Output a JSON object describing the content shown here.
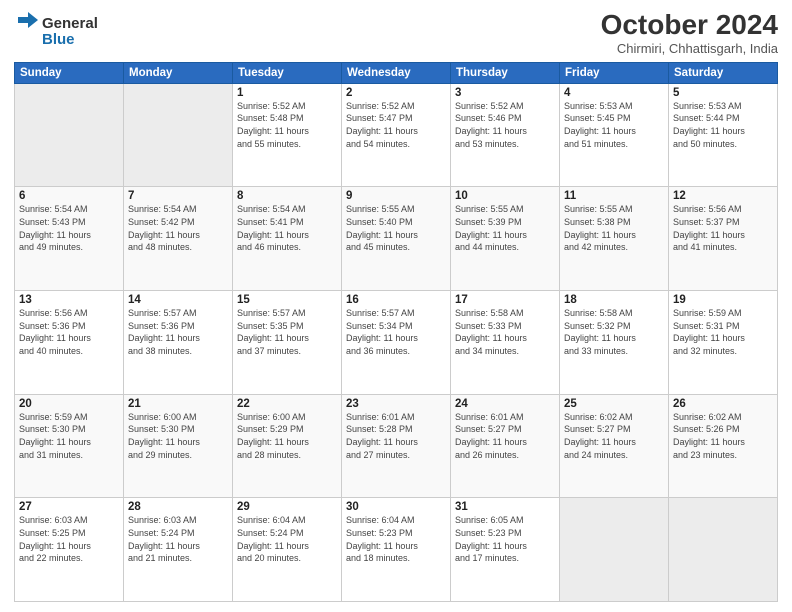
{
  "logo": {
    "line1": "General",
    "line2": "Blue"
  },
  "title": "October 2024",
  "subtitle": "Chirmiri, Chhattisgarh, India",
  "header_days": [
    "Sunday",
    "Monday",
    "Tuesday",
    "Wednesday",
    "Thursday",
    "Friday",
    "Saturday"
  ],
  "weeks": [
    [
      {
        "day": "",
        "info": ""
      },
      {
        "day": "",
        "info": ""
      },
      {
        "day": "1",
        "info": "Sunrise: 5:52 AM\nSunset: 5:48 PM\nDaylight: 11 hours\nand 55 minutes."
      },
      {
        "day": "2",
        "info": "Sunrise: 5:52 AM\nSunset: 5:47 PM\nDaylight: 11 hours\nand 54 minutes."
      },
      {
        "day": "3",
        "info": "Sunrise: 5:52 AM\nSunset: 5:46 PM\nDaylight: 11 hours\nand 53 minutes."
      },
      {
        "day": "4",
        "info": "Sunrise: 5:53 AM\nSunset: 5:45 PM\nDaylight: 11 hours\nand 51 minutes."
      },
      {
        "day": "5",
        "info": "Sunrise: 5:53 AM\nSunset: 5:44 PM\nDaylight: 11 hours\nand 50 minutes."
      }
    ],
    [
      {
        "day": "6",
        "info": "Sunrise: 5:54 AM\nSunset: 5:43 PM\nDaylight: 11 hours\nand 49 minutes."
      },
      {
        "day": "7",
        "info": "Sunrise: 5:54 AM\nSunset: 5:42 PM\nDaylight: 11 hours\nand 48 minutes."
      },
      {
        "day": "8",
        "info": "Sunrise: 5:54 AM\nSunset: 5:41 PM\nDaylight: 11 hours\nand 46 minutes."
      },
      {
        "day": "9",
        "info": "Sunrise: 5:55 AM\nSunset: 5:40 PM\nDaylight: 11 hours\nand 45 minutes."
      },
      {
        "day": "10",
        "info": "Sunrise: 5:55 AM\nSunset: 5:39 PM\nDaylight: 11 hours\nand 44 minutes."
      },
      {
        "day": "11",
        "info": "Sunrise: 5:55 AM\nSunset: 5:38 PM\nDaylight: 11 hours\nand 42 minutes."
      },
      {
        "day": "12",
        "info": "Sunrise: 5:56 AM\nSunset: 5:37 PM\nDaylight: 11 hours\nand 41 minutes."
      }
    ],
    [
      {
        "day": "13",
        "info": "Sunrise: 5:56 AM\nSunset: 5:36 PM\nDaylight: 11 hours\nand 40 minutes."
      },
      {
        "day": "14",
        "info": "Sunrise: 5:57 AM\nSunset: 5:36 PM\nDaylight: 11 hours\nand 38 minutes."
      },
      {
        "day": "15",
        "info": "Sunrise: 5:57 AM\nSunset: 5:35 PM\nDaylight: 11 hours\nand 37 minutes."
      },
      {
        "day": "16",
        "info": "Sunrise: 5:57 AM\nSunset: 5:34 PM\nDaylight: 11 hours\nand 36 minutes."
      },
      {
        "day": "17",
        "info": "Sunrise: 5:58 AM\nSunset: 5:33 PM\nDaylight: 11 hours\nand 34 minutes."
      },
      {
        "day": "18",
        "info": "Sunrise: 5:58 AM\nSunset: 5:32 PM\nDaylight: 11 hours\nand 33 minutes."
      },
      {
        "day": "19",
        "info": "Sunrise: 5:59 AM\nSunset: 5:31 PM\nDaylight: 11 hours\nand 32 minutes."
      }
    ],
    [
      {
        "day": "20",
        "info": "Sunrise: 5:59 AM\nSunset: 5:30 PM\nDaylight: 11 hours\nand 31 minutes."
      },
      {
        "day": "21",
        "info": "Sunrise: 6:00 AM\nSunset: 5:30 PM\nDaylight: 11 hours\nand 29 minutes."
      },
      {
        "day": "22",
        "info": "Sunrise: 6:00 AM\nSunset: 5:29 PM\nDaylight: 11 hours\nand 28 minutes."
      },
      {
        "day": "23",
        "info": "Sunrise: 6:01 AM\nSunset: 5:28 PM\nDaylight: 11 hours\nand 27 minutes."
      },
      {
        "day": "24",
        "info": "Sunrise: 6:01 AM\nSunset: 5:27 PM\nDaylight: 11 hours\nand 26 minutes."
      },
      {
        "day": "25",
        "info": "Sunrise: 6:02 AM\nSunset: 5:27 PM\nDaylight: 11 hours\nand 24 minutes."
      },
      {
        "day": "26",
        "info": "Sunrise: 6:02 AM\nSunset: 5:26 PM\nDaylight: 11 hours\nand 23 minutes."
      }
    ],
    [
      {
        "day": "27",
        "info": "Sunrise: 6:03 AM\nSunset: 5:25 PM\nDaylight: 11 hours\nand 22 minutes."
      },
      {
        "day": "28",
        "info": "Sunrise: 6:03 AM\nSunset: 5:24 PM\nDaylight: 11 hours\nand 21 minutes."
      },
      {
        "day": "29",
        "info": "Sunrise: 6:04 AM\nSunset: 5:24 PM\nDaylight: 11 hours\nand 20 minutes."
      },
      {
        "day": "30",
        "info": "Sunrise: 6:04 AM\nSunset: 5:23 PM\nDaylight: 11 hours\nand 18 minutes."
      },
      {
        "day": "31",
        "info": "Sunrise: 6:05 AM\nSunset: 5:23 PM\nDaylight: 11 hours\nand 17 minutes."
      },
      {
        "day": "",
        "info": ""
      },
      {
        "day": "",
        "info": ""
      }
    ]
  ]
}
